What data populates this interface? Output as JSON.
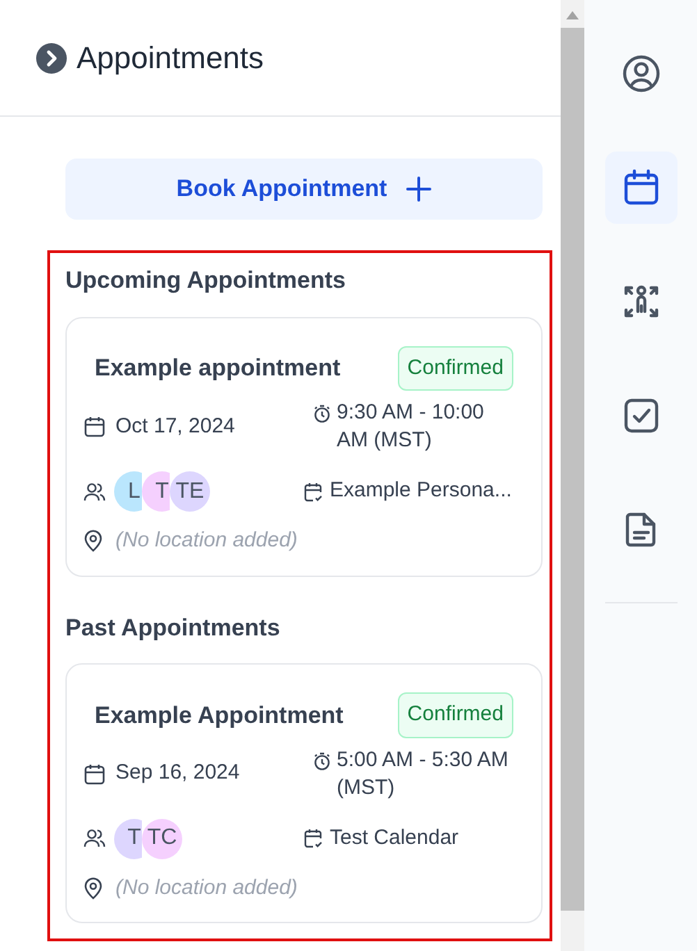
{
  "header": {
    "title": "Appointments"
  },
  "book_button": {
    "label": "Book Appointment"
  },
  "sections": [
    {
      "title": "Upcoming Appointments",
      "appointments": [
        {
          "title": "Example appointment",
          "status": "Confirmed",
          "date": "Oct 17, 2024",
          "time": "9:30 AM - 10:00 AM (MST)",
          "calendar": "Example Persona...",
          "location": "(No location added)",
          "attendees": [
            {
              "initials": "L",
              "color": "#bae6fd"
            },
            {
              "initials": "T",
              "color": "#f5d0fe"
            },
            {
              "initials": "TE",
              "color": "#ddd6fe"
            }
          ]
        }
      ]
    },
    {
      "title": "Past Appointments",
      "appointments": [
        {
          "title": "Example Appointment",
          "status": "Confirmed",
          "date": "Sep 16, 2024",
          "time": "5:00 AM - 5:30 AM (MST)",
          "calendar": "Test Calendar",
          "location": "(No location added)",
          "attendees": [
            {
              "initials": "T",
              "color": "#ddd6fe"
            },
            {
              "initials": "TC",
              "color": "#f5d0fe"
            }
          ]
        }
      ]
    }
  ],
  "rail": [
    {
      "kind": "contact",
      "selected": false
    },
    {
      "kind": "calendar",
      "selected": true
    },
    {
      "kind": "people",
      "selected": false
    },
    {
      "kind": "task",
      "selected": false
    },
    {
      "kind": "note",
      "selected": false
    }
  ]
}
